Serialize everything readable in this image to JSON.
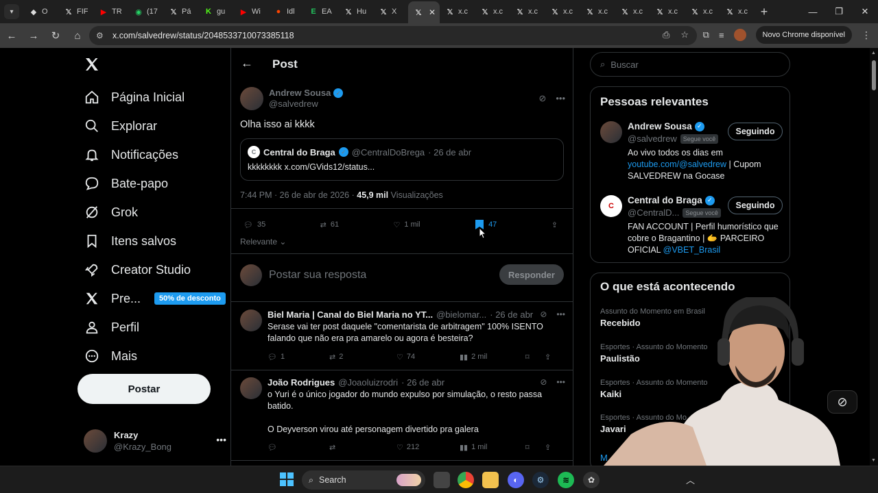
{
  "browser": {
    "tabs": [
      {
        "title": "O",
        "icon": "shield-icon",
        "color": "#dddddd"
      },
      {
        "title": "FIF",
        "icon": "x-logo-icon",
        "color": "#ffffff"
      },
      {
        "title": "TR",
        "icon": "youtube-icon",
        "color": "#ff0000"
      },
      {
        "title": "(17",
        "icon": "whatsapp-icon",
        "color": "#25d366"
      },
      {
        "title": "Pá",
        "icon": "x-logo-icon",
        "color": "#ffffff"
      },
      {
        "title": "gu",
        "icon": "kick-icon",
        "color": "#53fc18"
      },
      {
        "title": "Wi",
        "icon": "youtube-icon",
        "color": "#ff0000"
      },
      {
        "title": "Idl",
        "icon": "reddit-icon",
        "color": "#ff4500"
      },
      {
        "title": "EA",
        "icon": "ea-icon",
        "color": "#22c55e"
      },
      {
        "title": "Hu",
        "icon": "x-logo-icon",
        "color": "#ffffff"
      },
      {
        "title": "X",
        "icon": "x-logo-icon",
        "color": "#ffffff"
      },
      {
        "title": "",
        "icon": "x-logo-icon",
        "color": "#ffffff",
        "active": true
      },
      {
        "title": "x.c",
        "icon": "x-logo-icon",
        "color": "#ffffff"
      },
      {
        "title": "x.c",
        "icon": "x-logo-icon",
        "color": "#ffffff"
      },
      {
        "title": "x.c",
        "icon": "x-logo-icon",
        "color": "#ffffff"
      },
      {
        "title": "x.c",
        "icon": "x-logo-icon",
        "color": "#ffffff"
      },
      {
        "title": "x.c",
        "icon": "x-logo-icon",
        "color": "#ffffff"
      },
      {
        "title": "x.c",
        "icon": "x-logo-icon",
        "color": "#ffffff"
      },
      {
        "title": "x.c",
        "icon": "x-logo-icon",
        "color": "#ffffff"
      },
      {
        "title": "x.c",
        "icon": "x-logo-icon",
        "color": "#ffffff"
      },
      {
        "title": "x.c",
        "icon": "x-logo-icon",
        "color": "#ffffff"
      }
    ],
    "url": "x.com/salvedrew/status/2048533710073385118",
    "update_label": "Novo Chrome disponível"
  },
  "nav": {
    "items": [
      {
        "label": "Página Inicial",
        "icon": "home-icon"
      },
      {
        "label": "Explorar",
        "icon": "search-icon"
      },
      {
        "label": "Notificações",
        "icon": "bell-icon"
      },
      {
        "label": "Bate-papo",
        "icon": "chat-icon"
      },
      {
        "label": "Grok",
        "icon": "grok-icon"
      },
      {
        "label": "Itens salvos",
        "icon": "bookmark-icon"
      },
      {
        "label": "Creator Studio",
        "icon": "rocket-icon"
      },
      {
        "label": "Pre...",
        "icon": "x-logo-icon"
      },
      {
        "label": "Perfil",
        "icon": "person-icon"
      },
      {
        "label": "Mais",
        "icon": "more-circle-icon"
      }
    ],
    "premium_badge": "50% de desconto",
    "post_button": "Postar",
    "account": {
      "name": "Krazy",
      "handle": "@Krazy_Bong"
    }
  },
  "main": {
    "header_title": "Post",
    "tweet": {
      "author": "Andrew Sousa",
      "handle": "@salvedrew",
      "text": "Olha isso ai kkkk",
      "quote": {
        "author": "Central do Braga",
        "handle": "@CentralDoBrega",
        "date": "· 26 de abr",
        "text": "kkkkkkkk x.com/GVids12/status...",
        "avatar_text": "C"
      },
      "meta_time": "7:44 PM · 26 de abr de 2026 · ",
      "meta_views": "45,9 mil",
      "meta_views_label": " Visualizações",
      "stats": {
        "replies": "35",
        "reposts": "61",
        "likes": "1 mil",
        "bookmarks": "47"
      }
    },
    "relevance_label": "Relevante",
    "reply_placeholder": "Postar sua resposta",
    "reply_button": "Responder",
    "replies": [
      {
        "author": "Biel Maria | Canal do Biel Maria no YT...",
        "handle": "@bielomar...",
        "date": "· 26 de abr",
        "text": "Serase vai ter post daquele \"comentarista de arbitragem\" 100% ISENTO falando que não era pra amarelo ou agora é besteira?",
        "replies": "1",
        "reposts": "2",
        "likes": "74",
        "views": "2 mil"
      },
      {
        "author": "João Rodrigues",
        "handle": "@Joaoluizrodri",
        "date": "· 26 de abr",
        "text": "o Yuri é o único jogador do mundo expulso por simulação, o resto passa batido.",
        "text2": "O Deyverson virou até personagem divertido pra galera",
        "replies": "",
        "reposts": "",
        "likes": "212",
        "views": "1 mil"
      }
    ]
  },
  "right": {
    "search_placeholder": "Buscar",
    "people_title": "Pessoas relevantes",
    "people": [
      {
        "name": "Andrew Sousa",
        "handle": "@salvedrew",
        "follows_tag": "Segue você",
        "bio_pre": "Ao vivo todos os dias em ",
        "bio_link": "youtube.com/@salvedrew",
        "bio_post": " | Cupom SALVEDREW na Gocase",
        "button": "Seguindo"
      },
      {
        "name": "Central do Braga",
        "handle": "@CentralD...",
        "follows_tag": "Segue você",
        "bio_pre": "FAN ACCOUNT | Perfil humorístico que cobre o Bragantino | 🫱 PARCEIRO OFICIAL ",
        "bio_link": "@VBET_Brasil",
        "bio_post": "",
        "button": "Seguindo"
      }
    ],
    "trends_title": "O que está acontecendo",
    "trends": [
      {
        "category": "Assunto do Momento em Brasil",
        "name": "Recebido"
      },
      {
        "category": "Esportes · Assunto do Momento",
        "name": "Paulistão"
      },
      {
        "category": "Esportes · Assunto do Momento",
        "name": "Kaiki"
      },
      {
        "category": "Esportes · Assunto do Mo",
        "name": "Javari"
      }
    ],
    "show_more": "M"
  },
  "taskbar": {
    "search_label": "Search"
  },
  "colors": {
    "accent": "#1d9bf0",
    "bg": "#000000",
    "border": "#2f3336",
    "muted": "#71767b"
  }
}
